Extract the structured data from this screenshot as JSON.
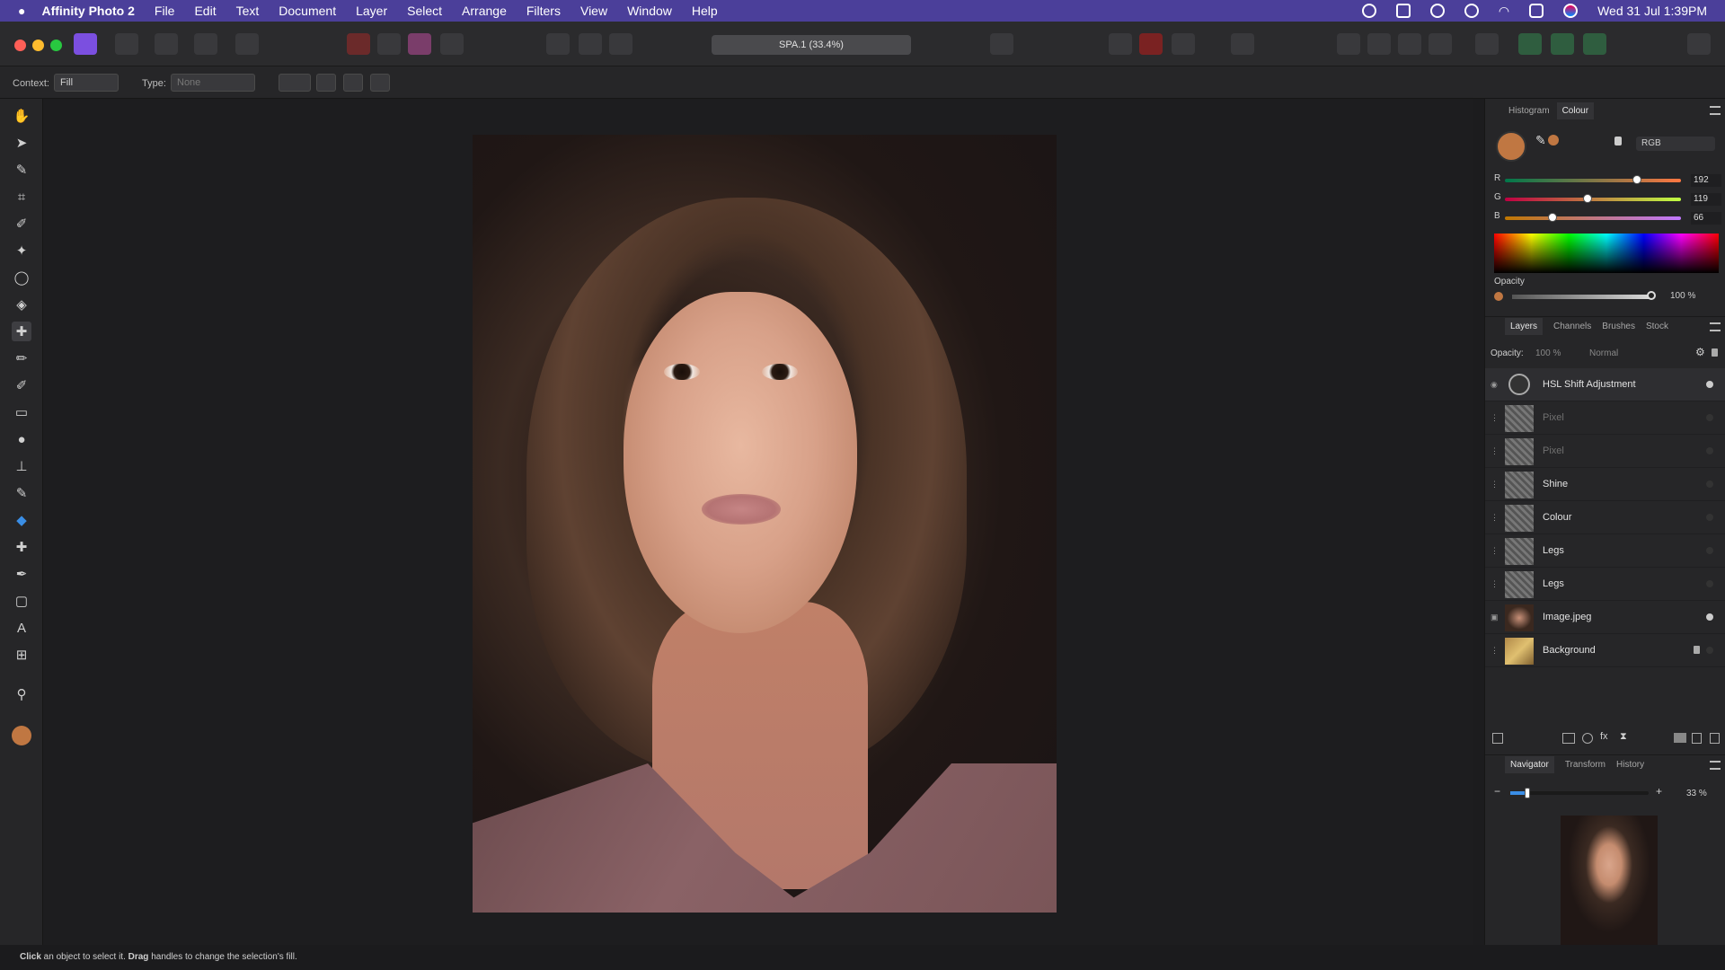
{
  "menubar": {
    "app_name": "Affinity Photo 2",
    "items": [
      "File",
      "Edit",
      "Text",
      "Document",
      "Layer",
      "Select",
      "Arrange",
      "Filters",
      "View",
      "Window",
      "Help"
    ],
    "clock": "Wed 31 Jul  1:39PM"
  },
  "toolbar": {
    "document_title": "SPA.1 (33.4%)"
  },
  "context_bar": {
    "context_label": "Context:",
    "context_value": "Fill",
    "type_label": "Type:",
    "type_value": "None"
  },
  "colour_panel": {
    "tabs": [
      "Histogram",
      "Colour"
    ],
    "model": "RGB",
    "r_label": "R",
    "r_value": "192",
    "g_label": "G",
    "g_value": "119",
    "b_label": "B",
    "b_value": "66",
    "opacity_label": "Opacity",
    "opacity_value": "100 %",
    "accent_color": "#C07742"
  },
  "layers_panel": {
    "tabs": [
      "Layers",
      "Channels",
      "Brushes",
      "Stock"
    ],
    "opacity_label": "Opacity:",
    "opacity_value": "100 %",
    "blend_mode": "Normal",
    "layers": [
      {
        "name": "HSL Shift Adjustment"
      },
      {
        "name": "Pixel"
      },
      {
        "name": "Pixel"
      },
      {
        "name": "Shine"
      },
      {
        "name": "Colour"
      },
      {
        "name": "Legs"
      },
      {
        "name": "Legs"
      },
      {
        "name": "Image.jpeg"
      },
      {
        "name": "Background"
      }
    ]
  },
  "navigator_panel": {
    "tabs": [
      "Navigator",
      "Transform",
      "History"
    ],
    "zoom": "33 %"
  },
  "statusbar": {
    "click": "Click",
    "text1": " an object to select it. ",
    "drag": "Drag",
    "text2": " handles to change the selection's fill."
  }
}
